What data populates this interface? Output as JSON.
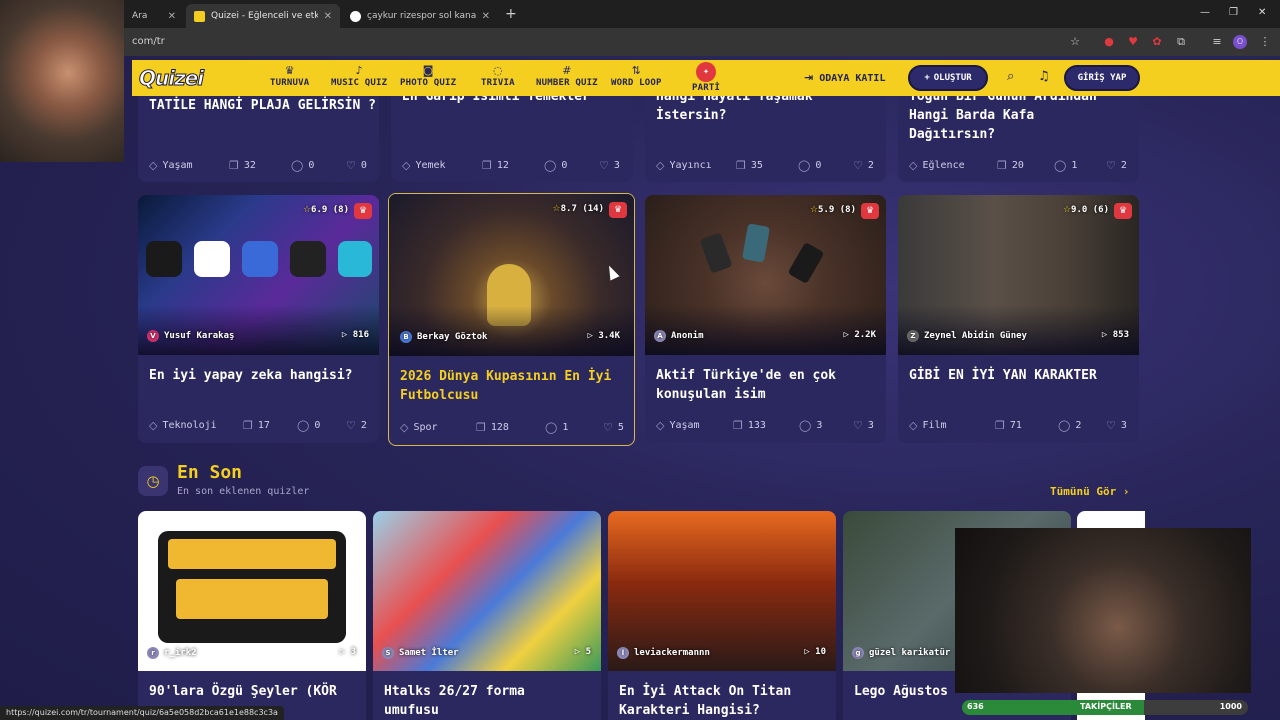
{
  "browser": {
    "tabs": [
      {
        "title": "Ara",
        "active": false
      },
      {
        "title": "Quizei - Eğlenceli ve etkileşimli",
        "active": true
      },
      {
        "title": "çaykur rizespor sol kanat - Goo",
        "active": false
      }
    ],
    "url": "com/tr",
    "status_url": "https://quizei.com/tr/tournament/quiz/6a5e058d2bca61e1e88c3c3a"
  },
  "site": {
    "logo": "Quizei",
    "nav": [
      {
        "label": "TURNUVA",
        "icon": "trophy-icon"
      },
      {
        "label": "MUSIC QUIZ",
        "icon": "music-note-icon"
      },
      {
        "label": "PHOTO QUIZ",
        "icon": "camera-icon"
      },
      {
        "label": "TRIVIA",
        "icon": "chat-question-icon"
      },
      {
        "label": "NUMBER QUIZ",
        "icon": "hash-icon"
      },
      {
        "label": "WORD LOOP",
        "icon": "sort-icon"
      },
      {
        "label": "PARTİ",
        "icon": "party-icon"
      }
    ],
    "join_room": "ODAYA KATIL",
    "create": "OLUŞTUR",
    "login": "GİRİŞ YAP"
  },
  "top_cards": [
    {
      "title": "TATİLE HANGİ PLAJA GELİRSİN ?",
      "category": "Yaşam",
      "questions": "32",
      "comments": "0",
      "likes": "0"
    },
    {
      "title": "En Garip İsimli Yemekler",
      "category": "Yemek",
      "questions": "12",
      "comments": "0",
      "likes": "3"
    },
    {
      "title": "Hangi Hayatı Yaşamak İstersin?",
      "category": "Yayıncı",
      "questions": "35",
      "comments": "0",
      "likes": "2"
    },
    {
      "title": "Yoğun Bir Günün Ardından Hangi Barda Kafa Dağıtırsın?",
      "category": "Eğlence",
      "questions": "20",
      "comments": "1",
      "likes": "2"
    }
  ],
  "cards": [
    {
      "title": "En iyi yapay zeka hangisi?",
      "category": "Teknoloji",
      "questions": "17",
      "comments": "0",
      "likes": "2",
      "rating": "6.9",
      "votes": "(8)",
      "author": "Yusuf Karakaş",
      "plays": "816"
    },
    {
      "title": "2026 Dünya Kupasının En İyi Futbolcusu",
      "category": "Spor",
      "questions": "128",
      "comments": "1",
      "likes": "5",
      "rating": "8.7",
      "votes": "(14)",
      "author": "Berkay Göztok",
      "plays": "3.4K"
    },
    {
      "title": "Aktif Türkiye'de en çok konuşulan isim",
      "category": "Yaşam",
      "questions": "133",
      "comments": "3",
      "likes": "3",
      "rating": "5.9",
      "votes": "(8)",
      "author": "Anonim",
      "plays": "2.2K"
    },
    {
      "title": "GİBİ EN İYİ YAN KARAKTER",
      "category": "Film",
      "questions": "71",
      "comments": "2",
      "likes": "3",
      "rating": "9.0",
      "votes": "(6)",
      "author": "Zeynel Abidin Güney",
      "plays": "853"
    }
  ],
  "latest": {
    "title": "En Son",
    "subtitle": "En son eklenen quizler",
    "see_all": "Tümünü Gör",
    "items": [
      {
        "title": "90'lara Özgü Şeyler (KÖR",
        "author": "r_irk2",
        "plays": "3"
      },
      {
        "title": "Htalks 26/27 forma umufusu",
        "author": "Samet İlter",
        "plays": "5"
      },
      {
        "title": "En İyi Attack On Titan Karakteri Hangisi?",
        "author": "leviackermannn",
        "plays": "10"
      },
      {
        "title": "Lego Ağustos",
        "author": "güzel karikatür",
        "plays": ""
      }
    ]
  },
  "overlay": {
    "followers_label": "TAKİPÇİLER",
    "followers_current": "636",
    "followers_goal": "1000",
    "followers_progress": 0.636
  },
  "colors": {
    "accent": "#f4cf1f",
    "bg": "#272457",
    "card": "#2b2860",
    "danger": "#e0383e"
  }
}
